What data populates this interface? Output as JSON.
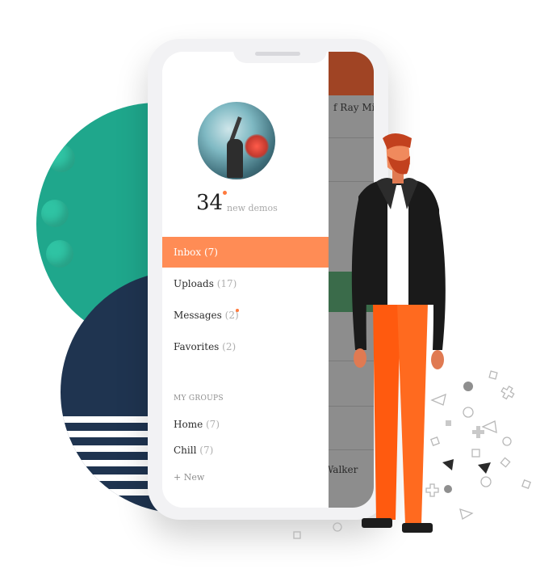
{
  "colors": {
    "accent": "#ff8c55",
    "teal": "#1fa78c",
    "navy": "#1f3450",
    "header": "#a04424",
    "orange_pants": "#ff5a0f"
  },
  "profile": {
    "count": "34",
    "count_label": "new demos"
  },
  "menu": {
    "items": [
      {
        "label": "Inbox",
        "count": "(7)",
        "active": true
      },
      {
        "label": "Uploads",
        "count": "(17)",
        "active": false
      },
      {
        "label": "Messages",
        "count": "(2)",
        "active": false
      },
      {
        "label": "Favorites",
        "count": "(2)",
        "active": false
      }
    ]
  },
  "groups": {
    "title": "MY GROUPS",
    "items": [
      {
        "label": "Home",
        "count": "(7)"
      },
      {
        "label": "Chill",
        "count": "(7)"
      }
    ],
    "new_label": "+ New"
  },
  "background_list": {
    "title_top": "f Ray Mi",
    "title_bottom": "Walker"
  }
}
